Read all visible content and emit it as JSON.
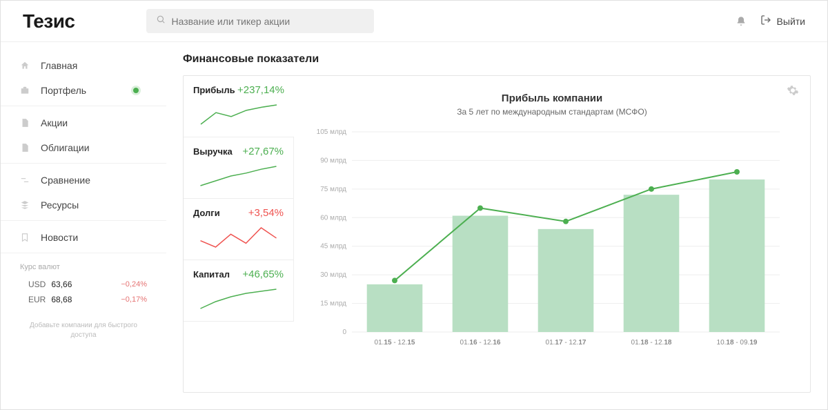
{
  "header": {
    "logo": "Тезис",
    "search_placeholder": "Название или тикер акции",
    "logout_label": "Выйти"
  },
  "sidebar": {
    "items": [
      {
        "label": "Главная",
        "icon": "home"
      },
      {
        "label": "Портфель",
        "icon": "briefcase",
        "dot": true
      },
      {
        "label": "Акции",
        "icon": "doc"
      },
      {
        "label": "Облигации",
        "icon": "doc"
      },
      {
        "label": "Сравнение",
        "icon": "compare"
      },
      {
        "label": "Ресурсы",
        "icon": "resources"
      },
      {
        "label": "Новости",
        "icon": "bookmark"
      }
    ],
    "rates_title": "Курс валют",
    "rates": [
      {
        "code": "USD",
        "value": "63,66",
        "change": "−0,24%"
      },
      {
        "code": "EUR",
        "value": "68,68",
        "change": "−0,17%"
      }
    ],
    "hint": "Добавьте компании\nдля быстрого доступа"
  },
  "main": {
    "title": "Финансовые показатели",
    "metrics": [
      {
        "name": "Прибыль",
        "change": "+237,14%",
        "dir": "pos",
        "spark": [
          20,
          35,
          30,
          38,
          42,
          45
        ]
      },
      {
        "name": "Выручка",
        "change": "+27,67%",
        "dir": "pos",
        "spark": [
          25,
          30,
          35,
          38,
          42,
          45
        ]
      },
      {
        "name": "Долги",
        "change": "+3,54%",
        "dir": "neg",
        "spark": [
          30,
          25,
          35,
          28,
          40,
          32
        ]
      },
      {
        "name": "Капитал",
        "change": "+46,65%",
        "dir": "pos",
        "spark": [
          18,
          28,
          35,
          40,
          43,
          46
        ]
      }
    ],
    "chart": {
      "title": "Прибыль компании",
      "subtitle": "За 5 лет по международным стандартам (МСФО)"
    }
  },
  "chart_data": {
    "type": "bar",
    "title": "Прибыль компании",
    "subtitle": "За 5 лет по международным стандартам (МСФО)",
    "ylabel": "",
    "ylim": [
      0,
      105
    ],
    "y_ticks": [
      0,
      15,
      30,
      45,
      60,
      75,
      90,
      105
    ],
    "y_tick_labels": [
      "0",
      "15 млрд",
      "30 млрд",
      "45 млрд",
      "60 млрд",
      "75 млрд",
      "90 млрд",
      "105 млрд"
    ],
    "categories": [
      "01.15 - 12.15",
      "01.16 - 12.16",
      "01.17 - 12.17",
      "01.18 - 12.18",
      "10.18 - 09.19"
    ],
    "series": [
      {
        "name": "bars",
        "type": "bar",
        "values": [
          25,
          61,
          54,
          72,
          80
        ]
      },
      {
        "name": "line",
        "type": "line",
        "values": [
          27,
          65,
          58,
          75,
          84
        ]
      }
    ]
  }
}
